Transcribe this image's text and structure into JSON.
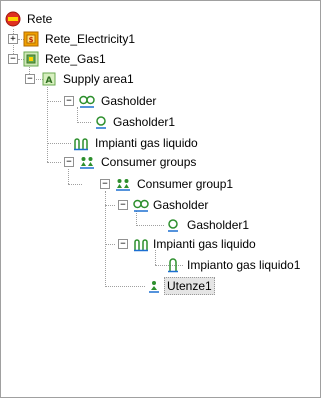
{
  "tree": {
    "root": {
      "label": "Rete"
    },
    "electricity": {
      "label": "Rete_Electricity1",
      "expander": "+"
    },
    "gas": {
      "label": "Rete_Gas1",
      "expander": "−"
    },
    "supply_area": {
      "label": "Supply area1",
      "expander": "−"
    },
    "gasholder_group": {
      "label": "Gasholder",
      "expander": "−"
    },
    "gasholder1": {
      "label": "Gasholder1"
    },
    "impianti_group": {
      "label": "Impianti gas liquido"
    },
    "consumer_groups": {
      "label": "Consumer groups",
      "expander": "−"
    },
    "consumer_group1": {
      "label": "Consumer group1",
      "expander": "−"
    },
    "cg_gasholder_group": {
      "label": "Gasholder",
      "expander": "−"
    },
    "cg_gasholder1": {
      "label": "Gasholder1"
    },
    "cg_impianti_group": {
      "label": "Impianti gas liquido",
      "expander": "−"
    },
    "cg_impianto1": {
      "label": "Impianto gas liquido1"
    },
    "utenze1": {
      "label": "Utenze1"
    }
  },
  "colors": {
    "root_icon": "#e03020",
    "electricity_icon": "#f0a000",
    "gas_icon": "#6aa84f",
    "gasholder_icon": "#2d8f2d",
    "consumer_icon": "#1c6fd1"
  }
}
